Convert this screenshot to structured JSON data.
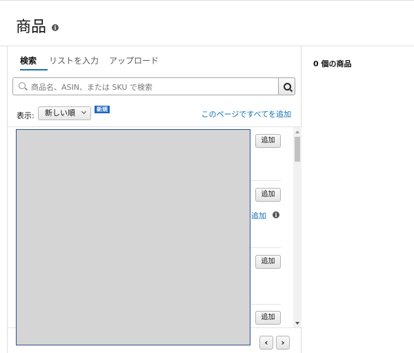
{
  "header": {
    "title": "商品",
    "info_icon": "info-icon"
  },
  "tabs": [
    {
      "label": "検索",
      "active": true
    },
    {
      "label": "リストを入力",
      "active": false
    },
    {
      "label": "アップロード",
      "active": false
    }
  ],
  "search": {
    "placeholder": "商品名、ASIN、または SKU で検索",
    "value": ""
  },
  "toolbar": {
    "sort_label": "表示:",
    "sort_selected": "新しい順",
    "new_badge": "新規",
    "add_all_link": "このページですべてを追加"
  },
  "results": {
    "add_button_label": "追加",
    "partial_link": "追加"
  },
  "right_panel": {
    "selected_count": "0 個の商品"
  },
  "colors": {
    "accent_link": "#0f6fb8",
    "badge": "#1e66c8",
    "tab_underline": "#1a6fa6"
  }
}
